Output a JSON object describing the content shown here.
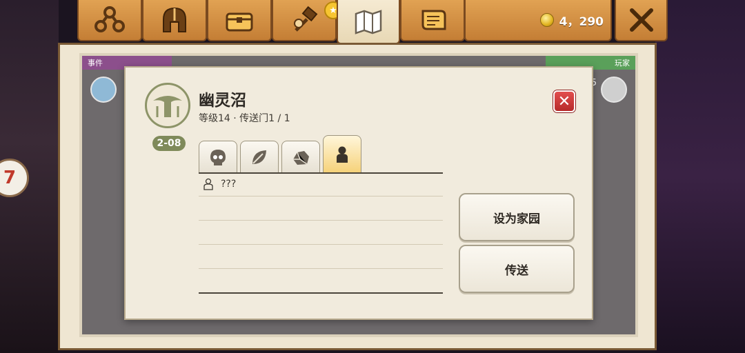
{
  "top_bar": {
    "tabs": [
      {
        "name": "group-tab",
        "icon": "group-icon"
      },
      {
        "name": "helmet-tab",
        "icon": "helmet-icon"
      },
      {
        "name": "chest-tab",
        "icon": "chest-icon"
      },
      {
        "name": "craft-tab",
        "icon": "hammer-icon"
      },
      {
        "name": "map-tab",
        "icon": "map-icon",
        "active": true
      },
      {
        "name": "scroll-tab",
        "icon": "scroll-icon"
      }
    ],
    "coins": "4，290"
  },
  "map": {
    "events_label": "事件",
    "players_label": "玩家",
    "player_count": "5"
  },
  "location": {
    "name": "幽灵沼",
    "subtitle": "等级14 · 传送门1 / 1",
    "level_chip": "2-08"
  },
  "filter_tabs": [
    {
      "name": "skull",
      "icon": "skull-icon"
    },
    {
      "name": "leaf",
      "icon": "leaf-icon"
    },
    {
      "name": "rock",
      "icon": "rock-icon"
    },
    {
      "name": "person",
      "icon": "person-icon",
      "active": true
    }
  ],
  "list_rows": [
    {
      "text": "???"
    },
    {
      "text": ""
    },
    {
      "text": ""
    },
    {
      "text": ""
    },
    {
      "text": ""
    }
  ],
  "buttons": {
    "set_home": "设为家园",
    "teleport": "传送"
  },
  "colors": {
    "wood": "#c47e35",
    "parchment": "#f1ebdd",
    "close_red": "#d23c3c",
    "accent_green": "#7f8a5a"
  }
}
